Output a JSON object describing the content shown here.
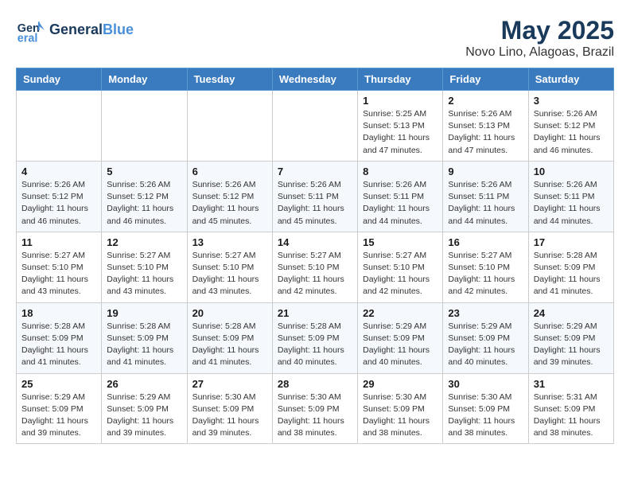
{
  "logo": {
    "line1": "General",
    "line2": "Blue"
  },
  "title": "May 2025",
  "subtitle": "Novo Lino, Alagoas, Brazil",
  "weekdays": [
    "Sunday",
    "Monday",
    "Tuesday",
    "Wednesday",
    "Thursday",
    "Friday",
    "Saturday"
  ],
  "weeks": [
    [
      {
        "day": "",
        "info": ""
      },
      {
        "day": "",
        "info": ""
      },
      {
        "day": "",
        "info": ""
      },
      {
        "day": "",
        "info": ""
      },
      {
        "day": "1",
        "info": "Sunrise: 5:25 AM\nSunset: 5:13 PM\nDaylight: 11 hours\nand 47 minutes."
      },
      {
        "day": "2",
        "info": "Sunrise: 5:26 AM\nSunset: 5:13 PM\nDaylight: 11 hours\nand 47 minutes."
      },
      {
        "day": "3",
        "info": "Sunrise: 5:26 AM\nSunset: 5:12 PM\nDaylight: 11 hours\nand 46 minutes."
      }
    ],
    [
      {
        "day": "4",
        "info": "Sunrise: 5:26 AM\nSunset: 5:12 PM\nDaylight: 11 hours\nand 46 minutes."
      },
      {
        "day": "5",
        "info": "Sunrise: 5:26 AM\nSunset: 5:12 PM\nDaylight: 11 hours\nand 46 minutes."
      },
      {
        "day": "6",
        "info": "Sunrise: 5:26 AM\nSunset: 5:12 PM\nDaylight: 11 hours\nand 45 minutes."
      },
      {
        "day": "7",
        "info": "Sunrise: 5:26 AM\nSunset: 5:11 PM\nDaylight: 11 hours\nand 45 minutes."
      },
      {
        "day": "8",
        "info": "Sunrise: 5:26 AM\nSunset: 5:11 PM\nDaylight: 11 hours\nand 44 minutes."
      },
      {
        "day": "9",
        "info": "Sunrise: 5:26 AM\nSunset: 5:11 PM\nDaylight: 11 hours\nand 44 minutes."
      },
      {
        "day": "10",
        "info": "Sunrise: 5:26 AM\nSunset: 5:11 PM\nDaylight: 11 hours\nand 44 minutes."
      }
    ],
    [
      {
        "day": "11",
        "info": "Sunrise: 5:27 AM\nSunset: 5:10 PM\nDaylight: 11 hours\nand 43 minutes."
      },
      {
        "day": "12",
        "info": "Sunrise: 5:27 AM\nSunset: 5:10 PM\nDaylight: 11 hours\nand 43 minutes."
      },
      {
        "day": "13",
        "info": "Sunrise: 5:27 AM\nSunset: 5:10 PM\nDaylight: 11 hours\nand 43 minutes."
      },
      {
        "day": "14",
        "info": "Sunrise: 5:27 AM\nSunset: 5:10 PM\nDaylight: 11 hours\nand 42 minutes."
      },
      {
        "day": "15",
        "info": "Sunrise: 5:27 AM\nSunset: 5:10 PM\nDaylight: 11 hours\nand 42 minutes."
      },
      {
        "day": "16",
        "info": "Sunrise: 5:27 AM\nSunset: 5:10 PM\nDaylight: 11 hours\nand 42 minutes."
      },
      {
        "day": "17",
        "info": "Sunrise: 5:28 AM\nSunset: 5:09 PM\nDaylight: 11 hours\nand 41 minutes."
      }
    ],
    [
      {
        "day": "18",
        "info": "Sunrise: 5:28 AM\nSunset: 5:09 PM\nDaylight: 11 hours\nand 41 minutes."
      },
      {
        "day": "19",
        "info": "Sunrise: 5:28 AM\nSunset: 5:09 PM\nDaylight: 11 hours\nand 41 minutes."
      },
      {
        "day": "20",
        "info": "Sunrise: 5:28 AM\nSunset: 5:09 PM\nDaylight: 11 hours\nand 41 minutes."
      },
      {
        "day": "21",
        "info": "Sunrise: 5:28 AM\nSunset: 5:09 PM\nDaylight: 11 hours\nand 40 minutes."
      },
      {
        "day": "22",
        "info": "Sunrise: 5:29 AM\nSunset: 5:09 PM\nDaylight: 11 hours\nand 40 minutes."
      },
      {
        "day": "23",
        "info": "Sunrise: 5:29 AM\nSunset: 5:09 PM\nDaylight: 11 hours\nand 40 minutes."
      },
      {
        "day": "24",
        "info": "Sunrise: 5:29 AM\nSunset: 5:09 PM\nDaylight: 11 hours\nand 39 minutes."
      }
    ],
    [
      {
        "day": "25",
        "info": "Sunrise: 5:29 AM\nSunset: 5:09 PM\nDaylight: 11 hours\nand 39 minutes."
      },
      {
        "day": "26",
        "info": "Sunrise: 5:29 AM\nSunset: 5:09 PM\nDaylight: 11 hours\nand 39 minutes."
      },
      {
        "day": "27",
        "info": "Sunrise: 5:30 AM\nSunset: 5:09 PM\nDaylight: 11 hours\nand 39 minutes."
      },
      {
        "day": "28",
        "info": "Sunrise: 5:30 AM\nSunset: 5:09 PM\nDaylight: 11 hours\nand 38 minutes."
      },
      {
        "day": "29",
        "info": "Sunrise: 5:30 AM\nSunset: 5:09 PM\nDaylight: 11 hours\nand 38 minutes."
      },
      {
        "day": "30",
        "info": "Sunrise: 5:30 AM\nSunset: 5:09 PM\nDaylight: 11 hours\nand 38 minutes."
      },
      {
        "day": "31",
        "info": "Sunrise: 5:31 AM\nSunset: 5:09 PM\nDaylight: 11 hours\nand 38 minutes."
      }
    ]
  ]
}
